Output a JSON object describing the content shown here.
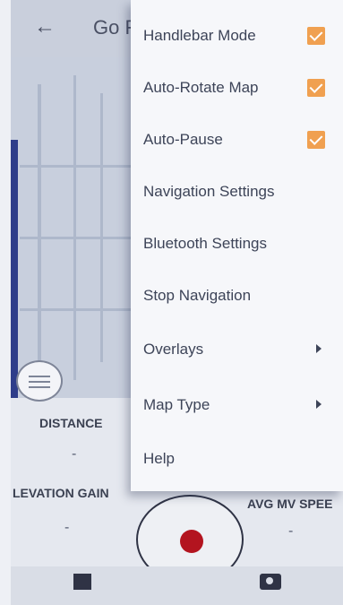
{
  "header": {
    "back_icon": "arrow-left-icon",
    "title": "Go F"
  },
  "stats": {
    "distance_label": "DISTANCE",
    "distance_value": "-",
    "elevation_label": "LEVATION GAIN",
    "elevation_value": "-",
    "avg_speed_label": "AVG MV SPEE",
    "avg_speed_value": "-"
  },
  "menu": {
    "items": [
      {
        "label": "Handlebar Mode",
        "checked": true
      },
      {
        "label": "Auto-Rotate Map",
        "checked": true
      },
      {
        "label": "Auto-Pause",
        "checked": true
      },
      {
        "label": "Navigation Settings"
      },
      {
        "label": "Bluetooth Settings"
      },
      {
        "label": "Stop Navigation"
      },
      {
        "label": "Overlays",
        "submenu": true
      },
      {
        "label": "Map Type",
        "submenu": true
      },
      {
        "label": "Help"
      }
    ]
  },
  "bottom": {
    "gallery_icon": "gallery-icon",
    "record_icon": "record-icon",
    "camera_icon": "camera-icon"
  },
  "colors": {
    "check": "#f0a050",
    "record": "#b3141f",
    "map_edge": "#2e3d8a"
  }
}
